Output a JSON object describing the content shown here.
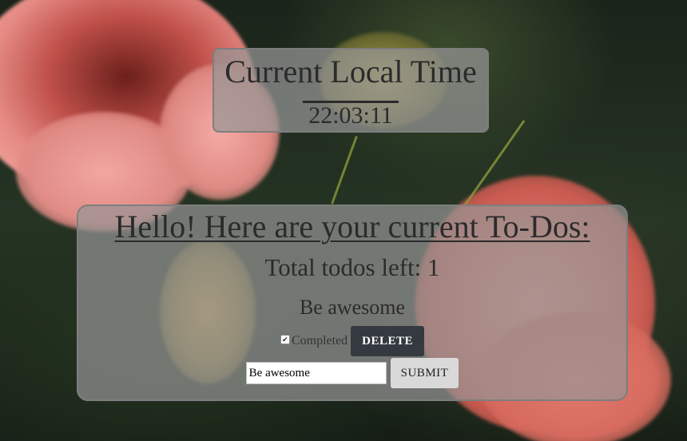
{
  "clock": {
    "title": "Current Local Time",
    "time": "22:03:11"
  },
  "todos": {
    "heading": "Hello! Here are your current To-Dos:",
    "count_text": "Total todos left: 1",
    "items": [
      {
        "text": "Be awesome",
        "completed_label": "Completed",
        "completed": true,
        "delete_label": "DELETE"
      }
    ],
    "input_value": "Be awesome",
    "submit_label": "SUBMIT"
  },
  "icons": {
    "checkbox": "checkmark-icon"
  },
  "colors": {
    "panel_bg": "#969696",
    "delete_bg": "#343a40",
    "submit_bg": "#d9d9d9",
    "text": "#2b2b2b"
  }
}
